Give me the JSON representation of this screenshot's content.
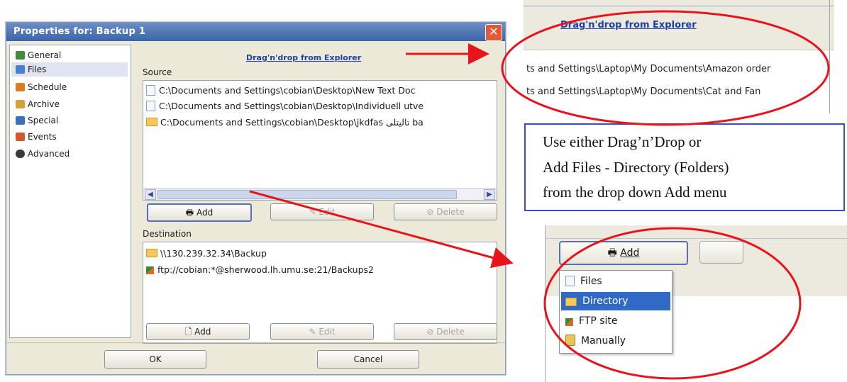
{
  "dialog": {
    "title": "Properties for: Backup 1",
    "close_label": "✕",
    "nav": [
      {
        "label": "General",
        "icon": "general-icon",
        "color": "#3f8f3a"
      },
      {
        "label": "Files",
        "icon": "files-icon",
        "color": "#4a7fd0"
      },
      {
        "label": "Schedule",
        "icon": "schedule-icon",
        "color": "#e07a20"
      },
      {
        "label": "Archive",
        "icon": "archive-icon",
        "color": "#d3a23a"
      },
      {
        "label": "Special",
        "icon": "special-icon",
        "color": "#3f6fb8"
      },
      {
        "label": "Events",
        "icon": "events-icon",
        "color": "#d05a2a"
      },
      {
        "label": "Advanced",
        "icon": "advanced-icon",
        "color": "#3a3a3a"
      }
    ],
    "drag_drop_link": "Drag'n'drop from Explorer",
    "source": {
      "label": "Source",
      "items": [
        "C:\\Documents and Settings\\cobian\\Desktop\\New Text Doc",
        "C:\\Documents and Settings\\cobian\\Desktop\\Individuell utve",
        "C:\\Documents and Settings\\cobian\\Desktop\\jkdfas تالیتلی ba"
      ],
      "add": "Add",
      "edit": "Edit",
      "delete": "Delete"
    },
    "destination": {
      "label": "Destination",
      "items": [
        "\\\\130.239.32.34\\Backup",
        "ftp://cobian:*@sherwood.lh.umu.se:21/Backups2"
      ],
      "add": "Add",
      "edit": "Edit",
      "delete": "Delete"
    },
    "ok": "OK",
    "cancel": "Cancel"
  },
  "zoom_top": {
    "link": "Drag'n'drop from Explorer",
    "rows": [
      "ts and Settings\\Laptop\\My Documents\\Amazon order",
      "ts and Settings\\Laptop\\My Documents\\Cat and Fan"
    ]
  },
  "note": {
    "lines": [
      "Use either Drag’n’Drop     or",
      "Add Files - Directory (Folders)",
      "from the drop down Add menu"
    ]
  },
  "add_menu": {
    "button": "Add",
    "items": [
      "Files",
      "Directory",
      "FTP site",
      "Manually"
    ],
    "highlighted": "Directory"
  },
  "colors": {
    "title_bar": "#3b64a6",
    "highlight": "#3169c6",
    "annotation_red": "#e8141c"
  }
}
